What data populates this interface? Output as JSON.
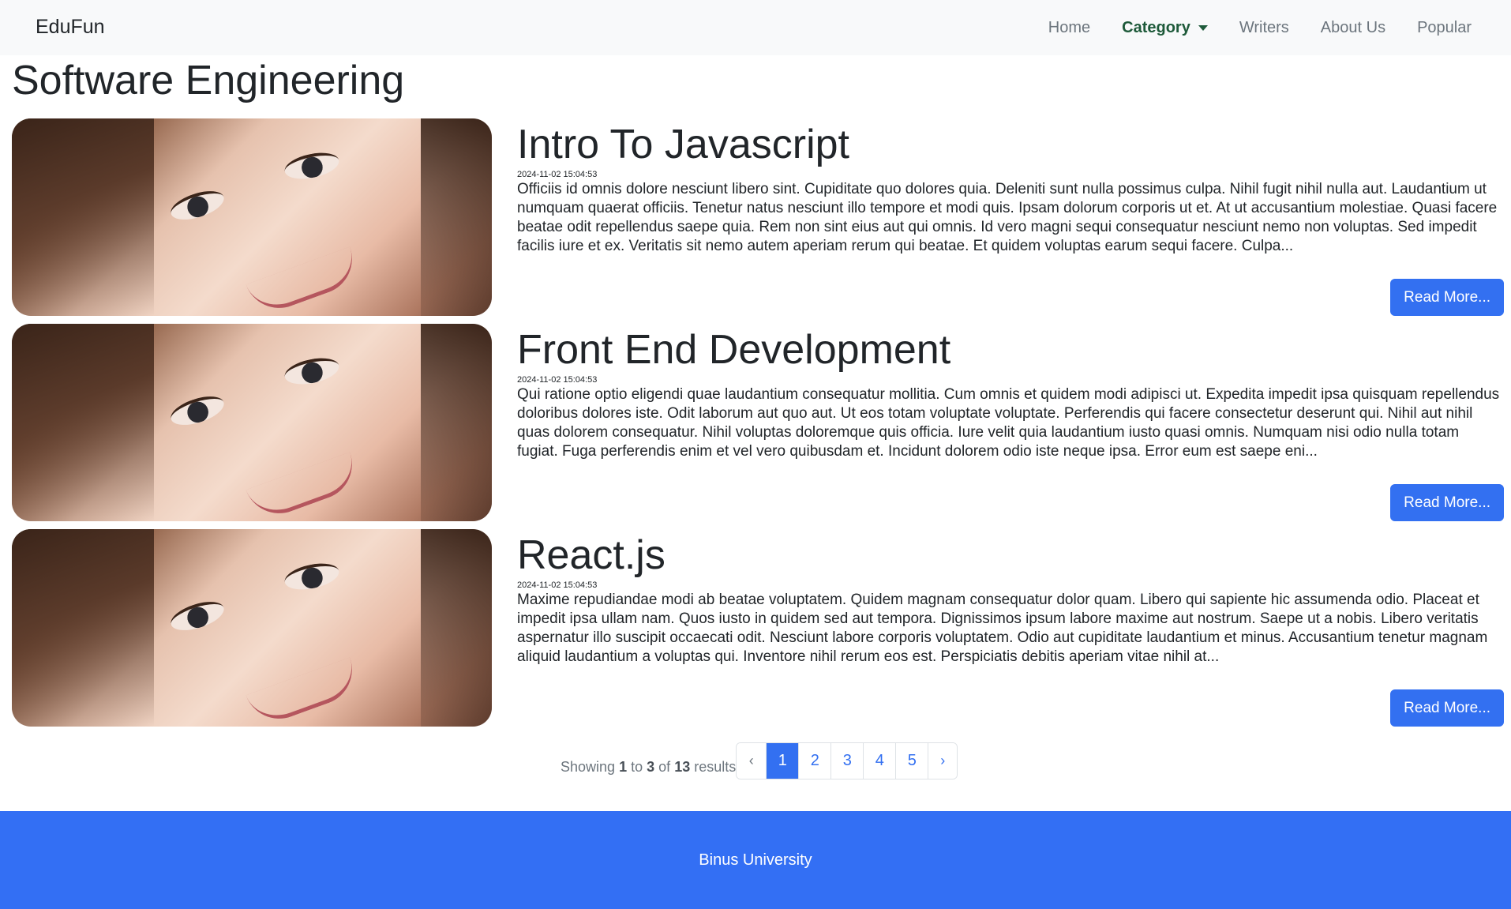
{
  "nav": {
    "brand": "EduFun",
    "items": [
      {
        "label": "Home"
      },
      {
        "label": "Category"
      },
      {
        "label": "Writers"
      },
      {
        "label": "About Us"
      },
      {
        "label": "Popular"
      }
    ]
  },
  "page_title": "Software Engineering",
  "articles": [
    {
      "title": "Intro To Javascript",
      "date": "2024-11-02 15:04:53",
      "excerpt": "Officiis id omnis dolore nesciunt libero sint. Cupiditate quo dolores quia. Deleniti sunt nulla possimus culpa. Nihil fugit nihil nulla aut. Laudantium ut numquam quaerat officiis. Tenetur natus nesciunt illo tempore et modi quis. Ipsam dolorum corporis ut et. At ut accusantium molestiae. Quasi facere beatae odit repellendus saepe quia. Rem non sint eius aut qui omnis. Id vero magni sequi consequatur nesciunt nemo non voluptas. Sed impedit facilis iure et ex. Veritatis sit nemo autem aperiam rerum qui beatae. Et quidem voluptas earum sequi facere. Culpa...",
      "button": "Read More..."
    },
    {
      "title": "Front End Development",
      "date": "2024-11-02 15:04:53",
      "excerpt": "Qui ratione optio eligendi quae laudantium consequatur mollitia. Cum omnis et quidem modi adipisci ut. Expedita impedit ipsa quisquam repellendus doloribus dolores iste. Odit laborum aut quo aut. Ut eos totam voluptate voluptate. Perferendis qui facere consectetur deserunt qui. Nihil aut nihil quas dolorem consequatur. Nihil voluptas doloremque quis officia. Iure velit quia laudantium iusto quasi omnis. Numquam nisi odio nulla totam fugiat. Fuga perferendis enim et vel vero quibusdam et. Incidunt dolorem odio iste neque ipsa. Error eum est saepe eni...",
      "button": "Read More..."
    },
    {
      "title": "React.js",
      "date": "2024-11-02 15:04:53",
      "excerpt": "Maxime repudiandae modi ab beatae voluptatem. Quidem magnam consequatur dolor quam. Libero qui sapiente hic assumenda odio. Placeat et impedit ipsa ullam nam. Quos iusto in quidem sed aut tempora. Dignissimos ipsum labore maxime aut nostrum. Saepe ut a nobis. Libero veritatis aspernatur illo suscipit occaecati odit. Nesciunt labore corporis voluptatem. Odio aut cupiditate laudantium et minus. Accusantium tenetur magnam aliquid laudantium a voluptas qui. Inventore nihil rerum eos est. Perspiciatis debitis aperiam vitae nihil at...",
      "button": "Read More..."
    }
  ],
  "pagination": {
    "showing_prefix": "Showing",
    "from": "1",
    "to_word": "to",
    "to": "3",
    "of_word": "of",
    "total": "13",
    "results_word": "results",
    "prev": "‹",
    "next": "›",
    "pages": [
      "1",
      "2",
      "3",
      "4",
      "5"
    ],
    "current": "1"
  },
  "footer": {
    "text": "Binus University"
  },
  "colors": {
    "primary": "#3370f1",
    "footer_bg": "#336ff4",
    "navbar_bg": "#f8f9fa",
    "nav_active": "#1e5a3a"
  }
}
